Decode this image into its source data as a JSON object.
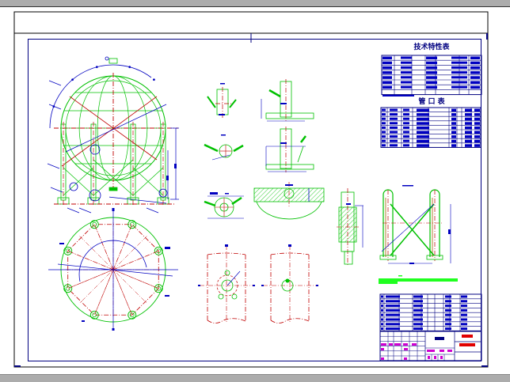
{
  "drawing": {
    "tech_table_title": "技术特性表",
    "nozzle_table_title": "管 口 表"
  },
  "colors": {
    "background": "#ffffff",
    "window_bar": "#acacac",
    "frame": "#000000",
    "border": "#000080",
    "outline": "#00c000",
    "centerline": "#c00000",
    "dimension": "#0000c0",
    "title_block_magenta": "#d000d0",
    "title_block_red": "#e00000",
    "note_green": "#20ff20"
  }
}
